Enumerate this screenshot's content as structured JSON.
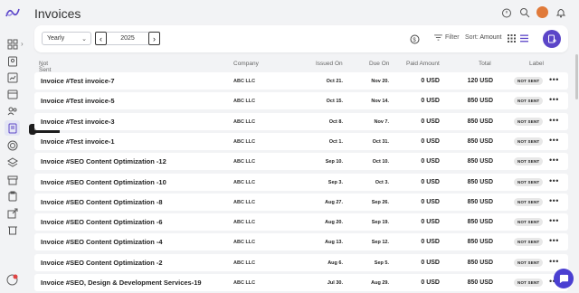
{
  "app": {
    "page_title": "Invoices",
    "tooltip": "Invoices"
  },
  "toolbar": {
    "period_value": "Yearly",
    "year": "2025",
    "filter_label": "Filter",
    "sort_label": "Sort:",
    "sort_value": "Amount"
  },
  "table": {
    "group": "Not Sent (43)",
    "headers": {
      "company": "Company",
      "issued": "Issued On",
      "due": "Due On",
      "paid": "Paid Amount",
      "total": "Total",
      "label": "Label"
    },
    "rows": [
      {
        "name": "Invoice #Test invoice-7",
        "company": "ABC LLC",
        "issued": "Oct 21.",
        "due": "Nov 20.",
        "paid": "0 USD",
        "total": "120 USD",
        "label": "NOT SENT"
      },
      {
        "name": "Invoice #Test invoice-5",
        "company": "ABC LLC",
        "issued": "Oct 15.",
        "due": "Nov 14.",
        "paid": "0 USD",
        "total": "850 USD",
        "label": "NOT SENT"
      },
      {
        "name": "Invoice #Test invoice-3",
        "company": "ABC LLC",
        "issued": "Oct 8.",
        "due": "Nov 7.",
        "paid": "0 USD",
        "total": "850 USD",
        "label": "NOT SENT"
      },
      {
        "name": "Invoice #Test invoice-1",
        "company": "ABC LLC",
        "issued": "Oct 1.",
        "due": "Oct 31.",
        "paid": "0 USD",
        "total": "850 USD",
        "label": "NOT SENT"
      },
      {
        "name": "Invoice #SEO Content Optimization -12",
        "company": "ABC LLC",
        "issued": "Sep 10.",
        "due": "Oct 10.",
        "paid": "0 USD",
        "total": "850 USD",
        "label": "NOT SENT"
      },
      {
        "name": "Invoice #SEO Content Optimization -10",
        "company": "ABC LLC",
        "issued": "Sep 3.",
        "due": "Oct 3.",
        "paid": "0 USD",
        "total": "850 USD",
        "label": "NOT SENT"
      },
      {
        "name": "Invoice #SEO Content Optimization -8",
        "company": "ABC LLC",
        "issued": "Aug 27.",
        "due": "Sep 26.",
        "paid": "0 USD",
        "total": "850 USD",
        "label": "NOT SENT"
      },
      {
        "name": "Invoice #SEO Content Optimization -6",
        "company": "ABC LLC",
        "issued": "Aug 20.",
        "due": "Sep 19.",
        "paid": "0 USD",
        "total": "850 USD",
        "label": "NOT SENT"
      },
      {
        "name": "Invoice #SEO Content Optimization -4",
        "company": "ABC LLC",
        "issued": "Aug 13.",
        "due": "Sep 12.",
        "paid": "0 USD",
        "total": "850 USD",
        "label": "NOT SENT"
      },
      {
        "name": "Invoice #SEO Content Optimization -2",
        "company": "ABC LLC",
        "issued": "Aug 6.",
        "due": "Sep 5.",
        "paid": "0 USD",
        "total": "850 USD",
        "label": "NOT SENT"
      },
      {
        "name": "Invoice #SEO, Design & Development Services-19",
        "company": "ABC LLC",
        "issued": "Jul 30.",
        "due": "Aug 29.",
        "paid": "0 USD",
        "total": "850 USD",
        "label": "NOT SENT"
      }
    ]
  },
  "icons": {
    "logo": "app-logo-icon",
    "sidebar": [
      "dashboard-icon",
      "contacts-icon",
      "reports-icon",
      "calendar-icon",
      "team-icon",
      "invoices-icon",
      "target-icon",
      "layers-icon",
      "clipboard-icon",
      "share-icon",
      "trash-icon"
    ],
    "top": [
      "timer-icon",
      "search-icon",
      "avatar",
      "bell-icon"
    ]
  },
  "colors": {
    "accent": "#5b45c8",
    "chat": "#4a3fd1",
    "badge_bg": "#e8e8e8"
  }
}
